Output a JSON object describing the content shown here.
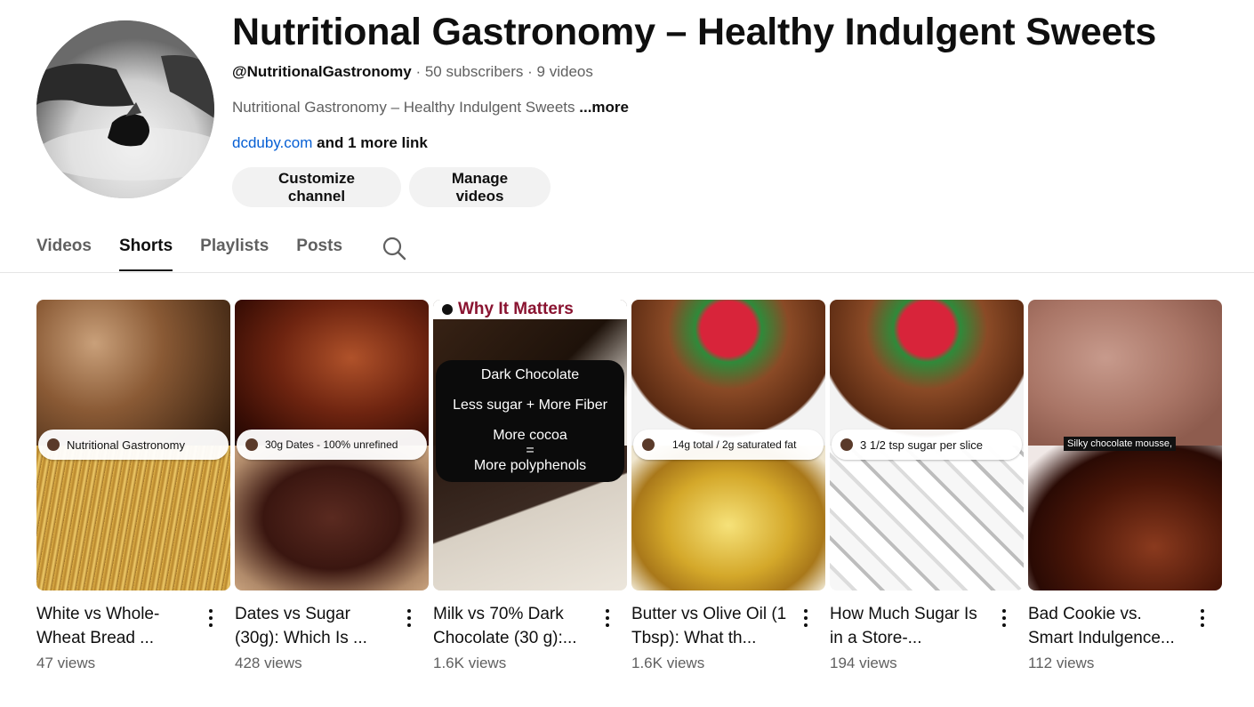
{
  "channel": {
    "title": "Nutritional Gastronomy – Healthy Indulgent Sweets",
    "handle": "@NutritionalGastronomy",
    "subscribers": "50 subscribers",
    "videos": "9 videos",
    "separator": "·",
    "description": "Nutritional Gastronomy – Healthy Indulgent Sweets",
    "more_label": "...more",
    "link_text": "dcduby.com",
    "more_links_text": "and 1 more link"
  },
  "buttons": {
    "customize": "Customize channel",
    "manage": "Manage videos"
  },
  "tabs": [
    {
      "label": "Videos",
      "active": false
    },
    {
      "label": "Shorts",
      "active": true
    },
    {
      "label": "Playlists",
      "active": false
    },
    {
      "label": "Posts",
      "active": false
    }
  ],
  "icons": {
    "search": "search-icon",
    "more": "more-vert-icon"
  },
  "shorts": [
    {
      "title": "White vs Whole-Wheat Bread ...",
      "views": "47 views",
      "overlay": "Nutritional Gastronomy"
    },
    {
      "title": "Dates vs Sugar (30g): Which Is ...",
      "views": "428 views",
      "overlay": "30g Dates - 100% unrefined"
    },
    {
      "title": "Milk vs 70% Dark Chocolate (30 g):...",
      "views": "1.6K views",
      "overlay_heading": "Why It Matters",
      "overlay_lines": [
        "Dark Chocolate",
        "Less sugar + More Fiber",
        "More cocoa",
        "=",
        "More polyphenols"
      ]
    },
    {
      "title": "Butter vs Olive Oil (1 Tbsp): What th...",
      "views": "1.6K views",
      "overlay": "14g total / 2g saturated fat"
    },
    {
      "title": "How Much Sugar Is in a Store-...",
      "views": "194 views",
      "overlay": "3 1/2 tsp sugar per slice"
    },
    {
      "title": "Bad Cookie vs. Smart Indulgence...",
      "views": "112 views",
      "overlay": "Silky chocolate mousse,"
    }
  ],
  "colors": {
    "accent_link": "#065fd4",
    "why_heading": "#8a1431",
    "muted_text": "#606060"
  }
}
